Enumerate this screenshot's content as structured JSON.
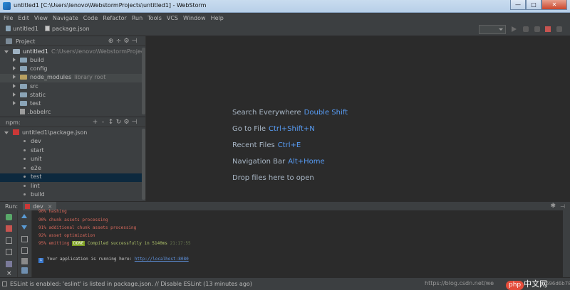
{
  "window": {
    "title": "untitled1 [C:\\Users\\lenovo\\WebstormProjects\\untitled1] - WebStorm",
    "minimize": "—",
    "maximize": "□",
    "close": "✕"
  },
  "menu": [
    "File",
    "Edit",
    "View",
    "Navigate",
    "Code",
    "Refactor",
    "Run",
    "Tools",
    "VCS",
    "Window",
    "Help"
  ],
  "navbar": {
    "project": "untitled1",
    "file": "package.json"
  },
  "project_panel": {
    "label": "Project",
    "tools": [
      "⊕",
      "÷",
      "⚙",
      "⊣"
    ],
    "root_name": "untitled1",
    "root_path": "C:\\Users\\lenovo\\WebstormProjects\\un",
    "items": [
      {
        "label": "build",
        "note": ""
      },
      {
        "label": "config",
        "note": ""
      },
      {
        "label": "node_modules",
        "note": "library root"
      },
      {
        "label": "src",
        "note": ""
      },
      {
        "label": "static",
        "note": ""
      },
      {
        "label": "test",
        "note": ""
      },
      {
        "label": ".babelrc",
        "note": ""
      }
    ]
  },
  "npm_panel": {
    "label": "npm:",
    "tools": [
      "+",
      "-",
      "↕",
      "↻",
      "⚙",
      "⊣"
    ],
    "package": "untitled1\\package.json",
    "scripts": [
      "dev",
      "start",
      "unit",
      "e2e",
      "test",
      "lint",
      "build"
    ],
    "selected": "test"
  },
  "welcome": [
    {
      "text": "Search Everywhere",
      "key": "Double Shift"
    },
    {
      "text": "Go to File",
      "key": "Ctrl+Shift+N"
    },
    {
      "text": "Recent Files",
      "key": "Ctrl+E"
    },
    {
      "text": "Navigation Bar",
      "key": "Alt+Home"
    },
    {
      "text": "Drop files here to open",
      "key": ""
    }
  ],
  "run": {
    "label": "Run:",
    "tab": "dev",
    "tab_close": "×",
    "gear": "✱",
    "hide": "⊣",
    "console": {
      "l0": "90% hashing",
      "l1": "90% chunk assets processing",
      "l2": "91% additional chunk assets processing",
      "l3": "92% asset optimization",
      "l4_pre": "95% emitting",
      "l4_done": "DONE",
      "l4_post": " Compiled successfully in 5140ms",
      "l4_time": "21:17:55",
      "l5_pre": "Your application is running here: ",
      "l5_link": "http://localhost:8080"
    }
  },
  "status": {
    "text": "ESLint is enabled: 'eslint' is listed in package.json. // Disable ESLint (13 minutes ago)",
    "watermark": "https://blog.csdn.net/we",
    "logo": "php",
    "logo_cn": "中文网",
    "extra": "696d6b78"
  },
  "colors": {
    "accent": "#589df6",
    "error_text": "#d8695c",
    "npm_red": "#cb3837",
    "selection": "#0d293e"
  }
}
